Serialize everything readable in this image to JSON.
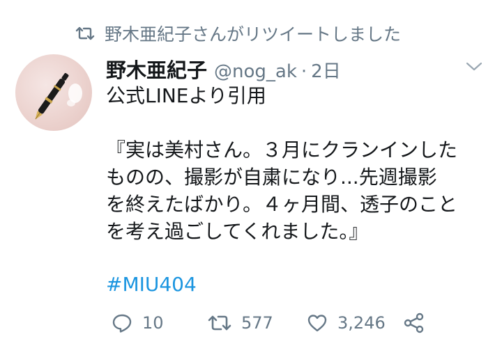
{
  "retweet_context": {
    "icon": "retweet-icon",
    "text": "野木亜紀子さんがリツイートしました"
  },
  "tweet": {
    "avatar_icon": "fountain-pen-avatar",
    "display_name": "野木亜紀子",
    "handle": "@nog_ak",
    "separator": "·",
    "time": "2日",
    "menu_icon": "chevron-down-icon",
    "text_line1": "公式LINEより引用",
    "quote": "『実は美村さん。３月にクランインした\nものの、撮影が自粛になり...先週撮影\nを終えたばかり。４ヶ月間、透子のこと\nを考え過ごしてくれました。』",
    "hashtag": "#MIU404"
  },
  "actions": {
    "reply": {
      "icon": "reply-icon",
      "count": "10"
    },
    "retweet": {
      "icon": "retweet-icon",
      "count": "577"
    },
    "like": {
      "icon": "heart-icon",
      "count": "3,246"
    },
    "share": {
      "icon": "share-icon"
    }
  },
  "colors": {
    "text": "#14171a",
    "muted": "#657786",
    "link": "#1b95e0"
  }
}
